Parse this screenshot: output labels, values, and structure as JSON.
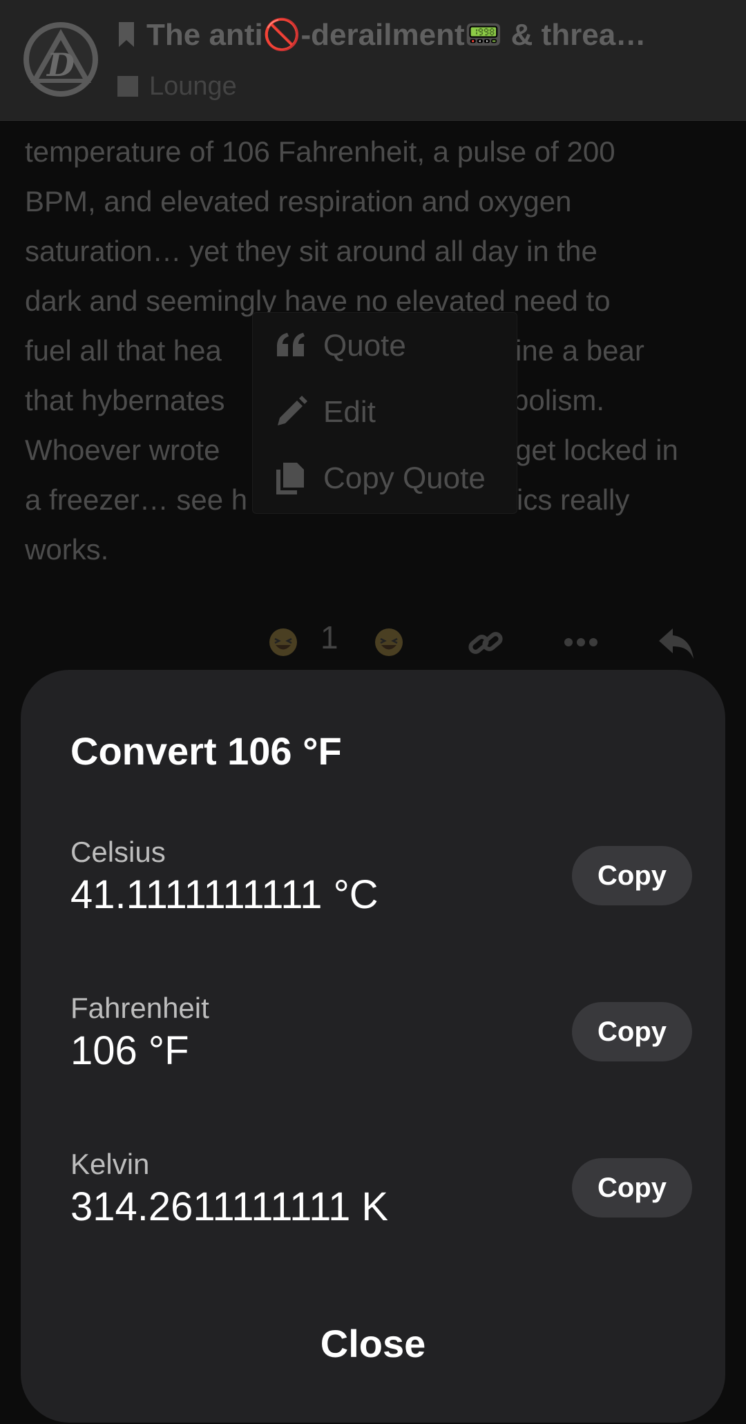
{
  "header": {
    "title": "The anti🚫-derailment📟 & threa…",
    "category": "Lounge",
    "colors": {
      "bar": "#232323",
      "title": "#606060"
    }
  },
  "post": {
    "lines": [
      "temperature of 106 Fahrenheit, a pulse of 200",
      "BPM, and elevated respiration and oxygen",
      "saturation… yet they sit around all day in the",
      "dark and seemingly have no elevated need to",
      "fuel all that hea",
      "that hybernates",
      "Whoever wrote",
      "a freezer… see h",
      "works."
    ],
    "line_tails": {
      "4": "ine a bear",
      "5": "bolism.",
      "6": "get locked in",
      "7": "ics really"
    }
  },
  "popup_menu": {
    "items": [
      {
        "label": "Quote",
        "icon": "quote-icon"
      },
      {
        "label": "Edit",
        "icon": "pencil-icon"
      },
      {
        "label": "Copy Quote",
        "icon": "copy-icon"
      }
    ]
  },
  "reactions": {
    "count": "1",
    "icons": [
      "laughing-emoji-icon",
      "link-icon",
      "more-icon",
      "reply-icon"
    ]
  },
  "converter": {
    "title": "Convert 106 °F",
    "units": [
      {
        "label": "Celsius",
        "value": "41.1111111111 °C",
        "copy_label": "Copy"
      },
      {
        "label": "Fahrenheit",
        "value": "106 °F",
        "copy_label": "Copy"
      },
      {
        "label": "Kelvin",
        "value": "314.2611111111 K",
        "copy_label": "Copy"
      }
    ],
    "close_label": "Close",
    "colors": {
      "sheet": "#222224",
      "button": "#39393c"
    }
  }
}
